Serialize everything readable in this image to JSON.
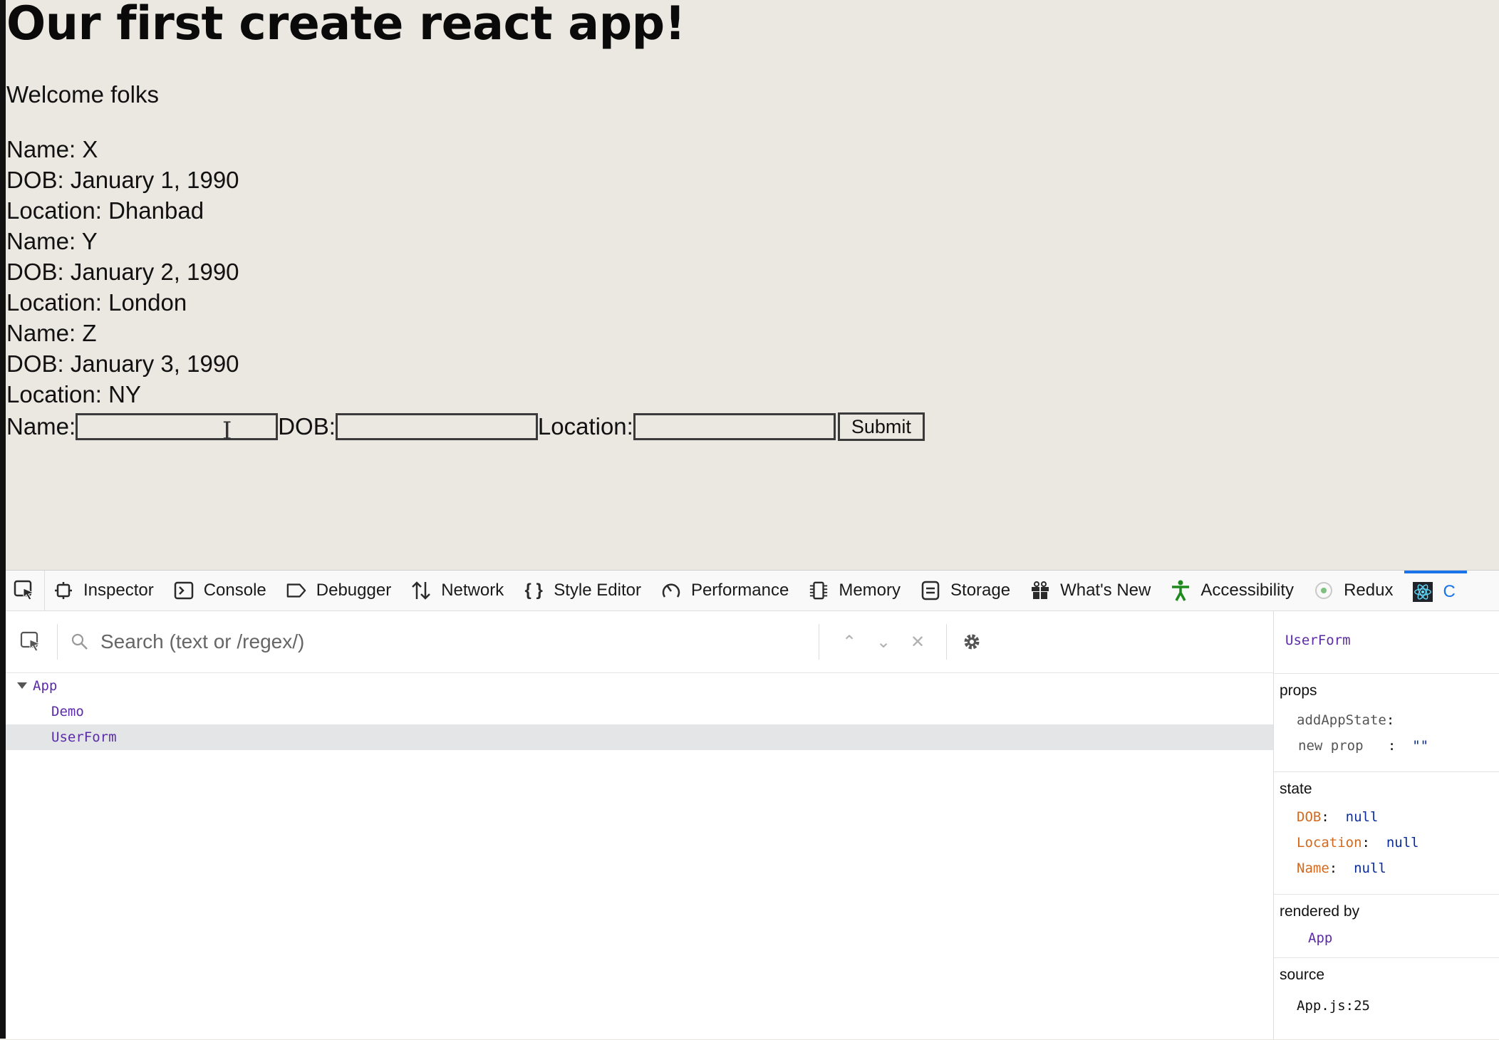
{
  "page": {
    "heading": "Our first create react app!",
    "welcome": "Welcome folks",
    "users": [
      {
        "name": "Name: X",
        "dob": "DOB: January 1, 1990",
        "location": "Location: Dhanbad"
      },
      {
        "name": "Name: Y",
        "dob": "DOB: January 2, 1990",
        "location": "Location: London"
      },
      {
        "name": "Name: Z",
        "dob": "DOB: January 3, 1990",
        "location": "Location: NY"
      }
    ],
    "form": {
      "name_label": "Name:",
      "name_value": "",
      "dob_label": "DOB:",
      "dob_value": "",
      "location_label": "Location:",
      "location_value": "",
      "submit_label": "Submit"
    }
  },
  "devtools": {
    "tabs": [
      {
        "label": "Inspector",
        "icon": "inspector-icon"
      },
      {
        "label": "Console",
        "icon": "console-icon"
      },
      {
        "label": "Debugger",
        "icon": "debugger-icon"
      },
      {
        "label": "Network",
        "icon": "network-icon"
      },
      {
        "label": "Style Editor",
        "icon": "style-editor-icon"
      },
      {
        "label": "Performance",
        "icon": "performance-icon"
      },
      {
        "label": "Memory",
        "icon": "memory-icon"
      },
      {
        "label": "Storage",
        "icon": "storage-icon"
      },
      {
        "label": "What's New",
        "icon": "gift-icon"
      },
      {
        "label": "Accessibility",
        "icon": "accessibility-icon"
      },
      {
        "label": "Redux",
        "icon": "redux-icon"
      },
      {
        "label": "C",
        "icon": "react-icon"
      }
    ],
    "active_tab_color": "#1a73e8",
    "search": {
      "placeholder": "Search (text or /regex/)",
      "value": ""
    },
    "tree": [
      {
        "label": "App",
        "expanded": true
      },
      {
        "label": "Demo"
      },
      {
        "label": "UserForm",
        "selected": true
      }
    ],
    "sidebar": {
      "title": "UserForm",
      "props_label": "props",
      "props": [
        {
          "key": "addAppState",
          "sep": ":",
          "value": ""
        },
        {
          "key": "new prop",
          "sep": ":",
          "value": "\"\""
        }
      ],
      "state_label": "state",
      "state": [
        {
          "key": "DOB",
          "sep": ":",
          "value": "null"
        },
        {
          "key": "Location",
          "sep": ":",
          "value": "null"
        },
        {
          "key": "Name",
          "sep": ":",
          "value": "null"
        }
      ],
      "rendered_by_label": "rendered by",
      "rendered_by": "App",
      "source_label": "source",
      "source": "App.js:25"
    }
  }
}
